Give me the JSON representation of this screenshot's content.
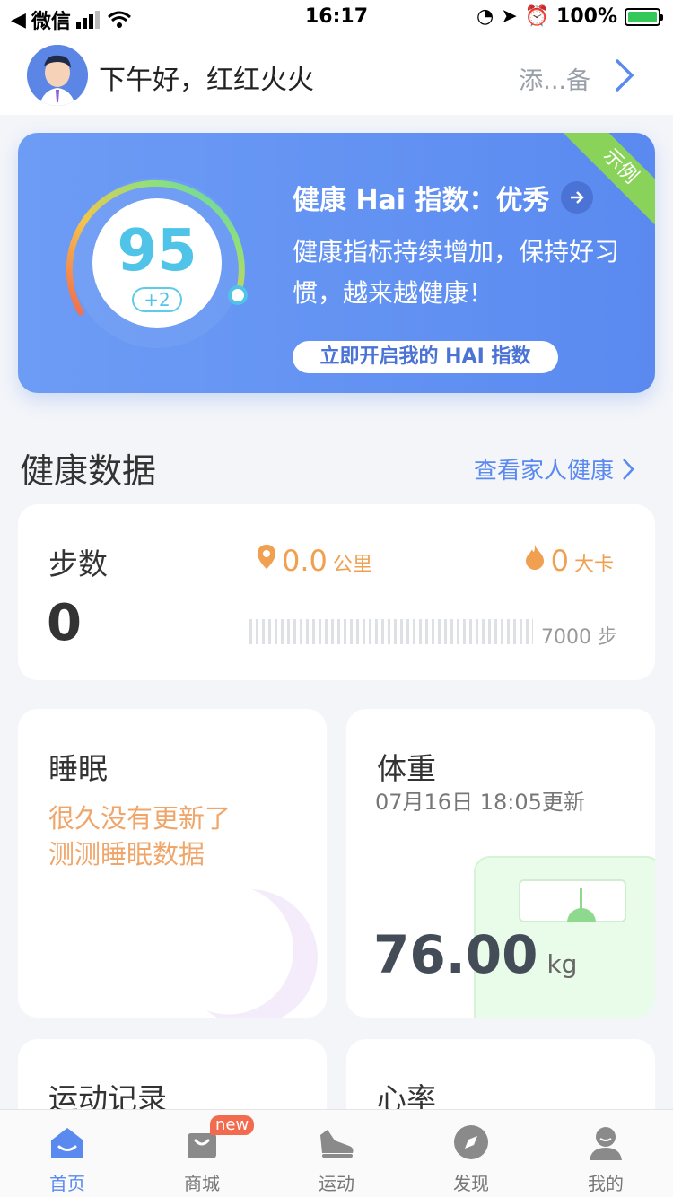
{
  "status_bar": {
    "carrier": "微信",
    "time": "16:17",
    "battery": "100%"
  },
  "header": {
    "greeting": "下午好，红红火火",
    "add_device": "添...备"
  },
  "hai": {
    "score": "95",
    "delta": "+2",
    "title": "健康 Hai 指数：优秀",
    "desc": "健康指标持续增加，保持好习惯，越来越健康！",
    "button": "立即开启我的 HAI 指数",
    "ribbon": "示例"
  },
  "section": {
    "title": "健康数据",
    "family_link": "查看家人健康"
  },
  "steps": {
    "title": "步数",
    "value": "0",
    "distance": "0.0",
    "distance_unit": "公里",
    "calories": "0",
    "calories_unit": "大卡",
    "goal": "7000 步"
  },
  "sleep": {
    "title": "睡眠",
    "line1": "很久没有更新了",
    "line2": "测测睡眠数据"
  },
  "weight": {
    "title": "体重",
    "updated": "07月16日 18:05更新",
    "value": "76.00",
    "unit": "kg"
  },
  "sport": {
    "title": "运动记录"
  },
  "heart": {
    "title": "心率"
  },
  "tabs": [
    {
      "label": "首页",
      "icon": "home-icon",
      "active": true
    },
    {
      "label": "商城",
      "icon": "shop-bag-icon",
      "badge": "new"
    },
    {
      "label": "运动",
      "icon": "shoe-icon"
    },
    {
      "label": "发现",
      "icon": "compass-icon"
    },
    {
      "label": "我的",
      "icon": "profile-icon"
    }
  ],
  "colors": {
    "accent": "#5a8af0",
    "orange": "#f0a050",
    "card_bg": "#ffffff",
    "page_bg": "#f3f5f9"
  }
}
